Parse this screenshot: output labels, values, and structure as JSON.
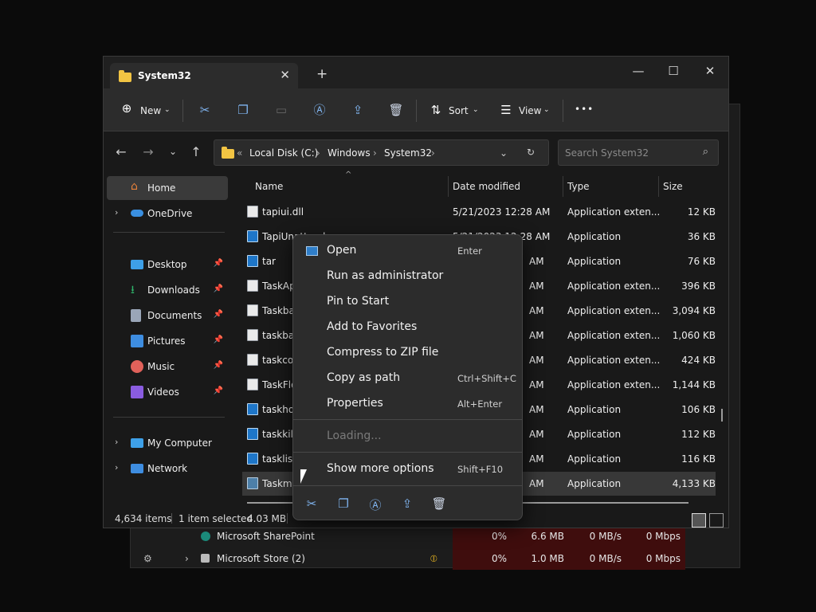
{
  "taskmanager": {
    "rows": [
      {
        "name": "Microsoft SharePoint",
        "cpu": "0%",
        "memory": "6.6 MB",
        "disk": "0 MB/s",
        "network": "0 Mbps"
      },
      {
        "name": "Microsoft Store (2)",
        "cpu": "0%",
        "memory": "1.0 MB",
        "disk": "0 MB/s",
        "network": "0 Mbps"
      }
    ]
  },
  "window": {
    "tab_title": "System32",
    "tab_close": "✕",
    "new_tab": "+",
    "minimize": "—",
    "maximize": "☐",
    "close": "✕"
  },
  "toolbar": {
    "new_label": "New",
    "sort_label": "Sort",
    "view_label": "View",
    "more": "•••"
  },
  "address": {
    "crumbs": [
      "Local Disk (C:)",
      "Windows",
      "System32"
    ],
    "separator": "›",
    "overflow": "«",
    "search_placeholder": "Search System32"
  },
  "sidebar": {
    "items": [
      {
        "label": "Home",
        "icon": "home-icon",
        "color": "#e8823a"
      },
      {
        "label": "OneDrive",
        "icon": "cloud-icon",
        "color": "#3a8fe0"
      },
      {
        "label": "Desktop",
        "icon": "desktop-icon",
        "color": "#3ea0e8"
      },
      {
        "label": "Downloads",
        "icon": "download-icon",
        "color": "#2fb56b"
      },
      {
        "label": "Documents",
        "icon": "document-icon",
        "color": "#9aa6b8"
      },
      {
        "label": "Pictures",
        "icon": "picture-icon",
        "color": "#3e8de0"
      },
      {
        "label": "Music",
        "icon": "music-icon",
        "color": "#e0615a"
      },
      {
        "label": "Videos",
        "icon": "video-icon",
        "color": "#8a5ce0"
      },
      {
        "label": "My Computer",
        "icon": "computer-icon",
        "color": "#3ea0e8"
      },
      {
        "label": "Network",
        "icon": "network-icon",
        "color": "#3e8de0"
      }
    ]
  },
  "columns": {
    "name": "Name",
    "date": "Date modified",
    "type": "Type",
    "size": "Size"
  },
  "files": [
    {
      "name": "tapiui.dll",
      "date": "5/21/2023 12:28 AM",
      "type": "Application exten...",
      "size": "12 KB"
    },
    {
      "name": "TapiUnattend",
      "date": "5/21/2023 12:28 AM",
      "type": "Application",
      "size": "36 KB"
    },
    {
      "name": "tar",
      "date": "AM",
      "type": "Application",
      "size": "76 KB"
    },
    {
      "name": "TaskApis.dll",
      "date": "AM",
      "type": "Application exten...",
      "size": "396 KB"
    },
    {
      "name": "Taskbar.dll",
      "date": "AM",
      "type": "Application exten...",
      "size": "3,094 KB"
    },
    {
      "name": "taskbarcpl.dll",
      "date": "AM",
      "type": "Application exten...",
      "size": "1,060 KB"
    },
    {
      "name": "taskcomp.dll",
      "date": "AM",
      "type": "Application exten...",
      "size": "424 KB"
    },
    {
      "name": "TaskFlowDataEngine.dll",
      "date": "AM",
      "type": "Application exten...",
      "size": "1,144 KB"
    },
    {
      "name": "taskhostw",
      "date": "AM",
      "type": "Application",
      "size": "106 KB"
    },
    {
      "name": "taskkill",
      "date": "AM",
      "type": "Application",
      "size": "112 KB"
    },
    {
      "name": "tasklist",
      "date": "AM",
      "type": "Application",
      "size": "116 KB"
    },
    {
      "name": "Taskmgr",
      "date": "AM",
      "type": "Application",
      "size": "4,133 KB"
    }
  ],
  "status": {
    "count": "4,634 items",
    "selected": "1 item selected",
    "size": "4.03 MB"
  },
  "context_menu": {
    "items": [
      {
        "label": "Open",
        "shortcut": "Enter"
      },
      {
        "label": "Run as administrator",
        "shortcut": ""
      },
      {
        "label": "Pin to Start",
        "shortcut": ""
      },
      {
        "label": "Add to Favorites",
        "shortcut": ""
      },
      {
        "label": "Compress to ZIP file",
        "shortcut": ""
      },
      {
        "label": "Copy as path",
        "shortcut": "Ctrl+Shift+C"
      },
      {
        "label": "Properties",
        "shortcut": "Alt+Enter"
      },
      {
        "label": "Loading...",
        "shortcut": ""
      },
      {
        "label": "Show more options",
        "shortcut": "Shift+F10"
      }
    ]
  },
  "colors": {
    "accent": "#3a8fe0",
    "folder": "#f2c443",
    "taskmgr_heat": "#3f0d0d"
  }
}
